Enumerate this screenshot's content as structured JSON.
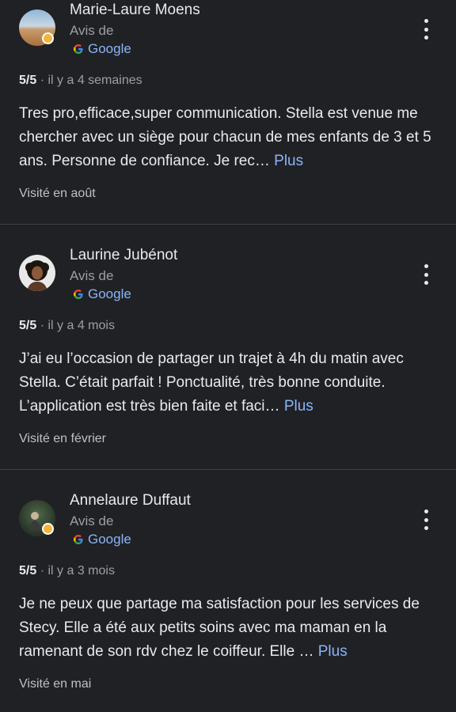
{
  "source_label": "Avis de",
  "google_label": "Google",
  "more_label": "Plus",
  "reviews": [
    {
      "name": "Marie-Laure Moens",
      "rating": "5/5",
      "time": " · il y a 4 semaines",
      "text": "Tres pro,efficace,super communication. Stella est venue me chercher avec un siège pour chacun de mes enfants de 3 et 5 ans. Personne de confiance. Je rec… ",
      "visited": "Visité en août"
    },
    {
      "name": "Laurine Jubénot",
      "rating": "5/5",
      "time": " · il y a 4 mois",
      "text": "J’ai eu l’occasion de partager un trajet à 4h du matin avec Stella. C’était parfait ! Ponctualité, très bonne conduite. L’application est très bien faite et faci… ",
      "visited": "Visité en février"
    },
    {
      "name": "Annelaure Duffaut",
      "rating": "5/5",
      "time": " · il y a 3 mois",
      "text": "Je ne peux que partage ma satisfaction pour les services de Stecy. Elle a été aux petits soins avec ma maman en la ramenant de son rdv chez le coiffeur. Elle … ",
      "visited": "Visité en mai"
    }
  ]
}
